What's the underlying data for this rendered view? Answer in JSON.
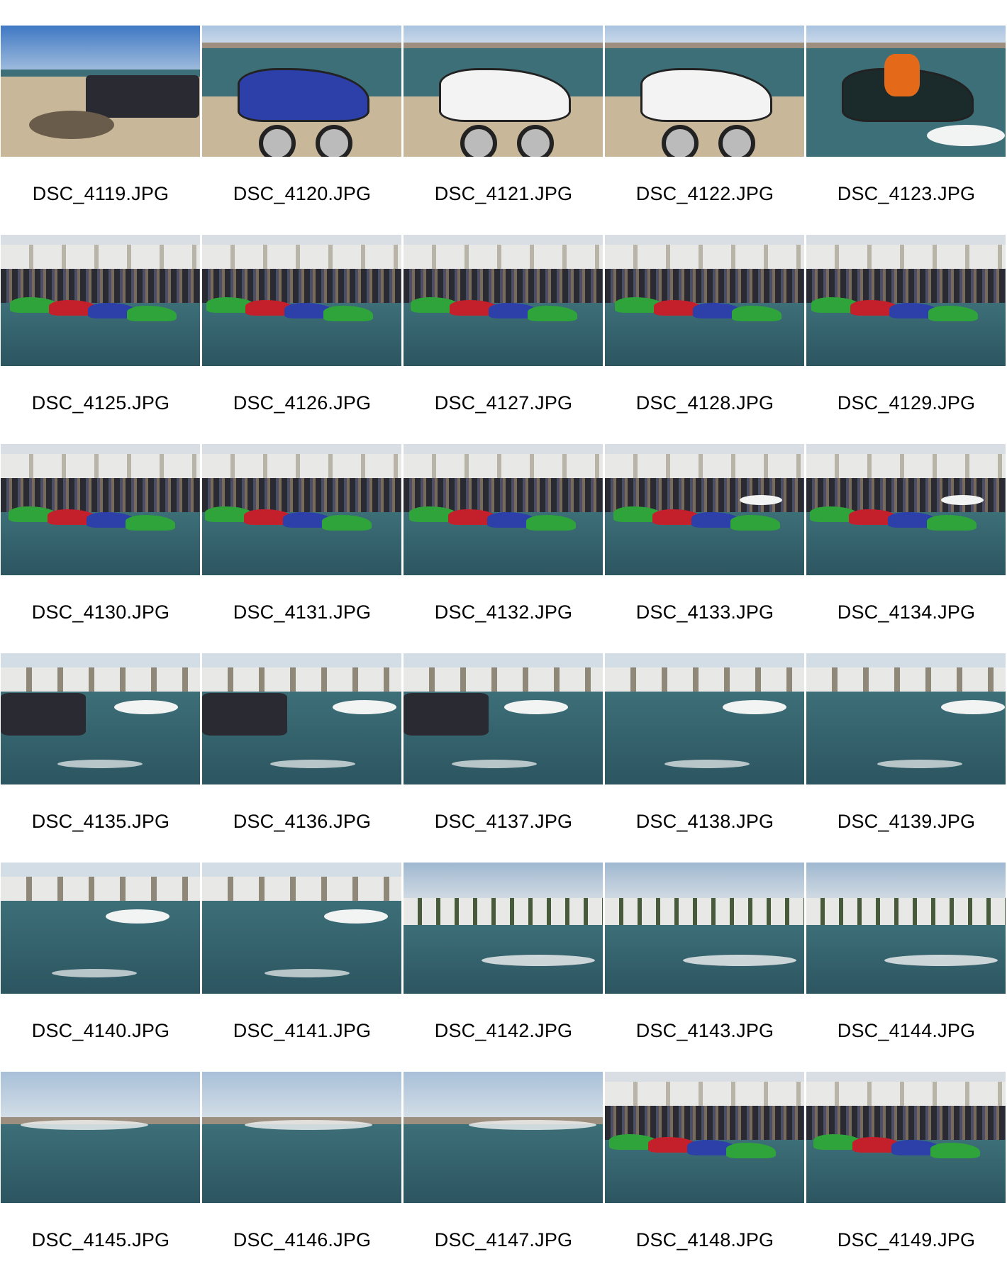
{
  "sheet": {
    "columns": 5,
    "items": [
      {
        "filename": "DSC_4119.JPG",
        "scene": "beach"
      },
      {
        "filename": "DSC_4120.JPG",
        "scene": "trailer-blue"
      },
      {
        "filename": "DSC_4121.JPG",
        "scene": "trailer-white"
      },
      {
        "filename": "DSC_4122.JPG",
        "scene": "trailer-riders"
      },
      {
        "filename": "DSC_4123.JPG",
        "scene": "rider"
      },
      {
        "filename": "DSC_4125.JPG",
        "scene": "crowd"
      },
      {
        "filename": "DSC_4126.JPG",
        "scene": "crowd"
      },
      {
        "filename": "DSC_4127.JPG",
        "scene": "crowd"
      },
      {
        "filename": "DSC_4128.JPG",
        "scene": "crowd"
      },
      {
        "filename": "DSC_4129.JPG",
        "scene": "crowd"
      },
      {
        "filename": "DSC_4130.JPG",
        "scene": "crowd"
      },
      {
        "filename": "DSC_4131.JPG",
        "scene": "crowd"
      },
      {
        "filename": "DSC_4132.JPG",
        "scene": "crowd"
      },
      {
        "filename": "DSC_4133.JPG",
        "scene": "crowd-race"
      },
      {
        "filename": "DSC_4134.JPG",
        "scene": "crowd-race"
      },
      {
        "filename": "DSC_4135.JPG",
        "scene": "race-shore"
      },
      {
        "filename": "DSC_4136.JPG",
        "scene": "race-shore"
      },
      {
        "filename": "DSC_4137.JPG",
        "scene": "race-shore"
      },
      {
        "filename": "DSC_4138.JPG",
        "scene": "race-open"
      },
      {
        "filename": "DSC_4139.JPG",
        "scene": "race-open"
      },
      {
        "filename": "DSC_4140.JPG",
        "scene": "race-close"
      },
      {
        "filename": "DSC_4141.JPG",
        "scene": "race-close"
      },
      {
        "filename": "DSC_4142.JPG",
        "scene": "shore-far"
      },
      {
        "filename": "DSC_4143.JPG",
        "scene": "shore-far"
      },
      {
        "filename": "DSC_4144.JPG",
        "scene": "shore-far"
      },
      {
        "filename": "DSC_4145.JPG",
        "scene": "lake-far"
      },
      {
        "filename": "DSC_4146.JPG",
        "scene": "lake-far"
      },
      {
        "filename": "DSC_4147.JPG",
        "scene": "lake-far"
      },
      {
        "filename": "DSC_4148.JPG",
        "scene": "crowd"
      },
      {
        "filename": "DSC_4149.JPG",
        "scene": "crowd"
      }
    ]
  },
  "palette": {
    "sky": "#a9c3df",
    "sky_deep": "#3f78c4",
    "water": "#3d6f78",
    "water_deep": "#2c5560",
    "sand": "#c9b79a",
    "hills": "#9d8f80",
    "rv_white": "#e8e8e6",
    "crowd": "#2a2a32",
    "ski_green": "#2fa43a",
    "ski_red": "#c4202c",
    "ski_blue": "#2d3fa8",
    "spray": "#f2f4f4"
  }
}
